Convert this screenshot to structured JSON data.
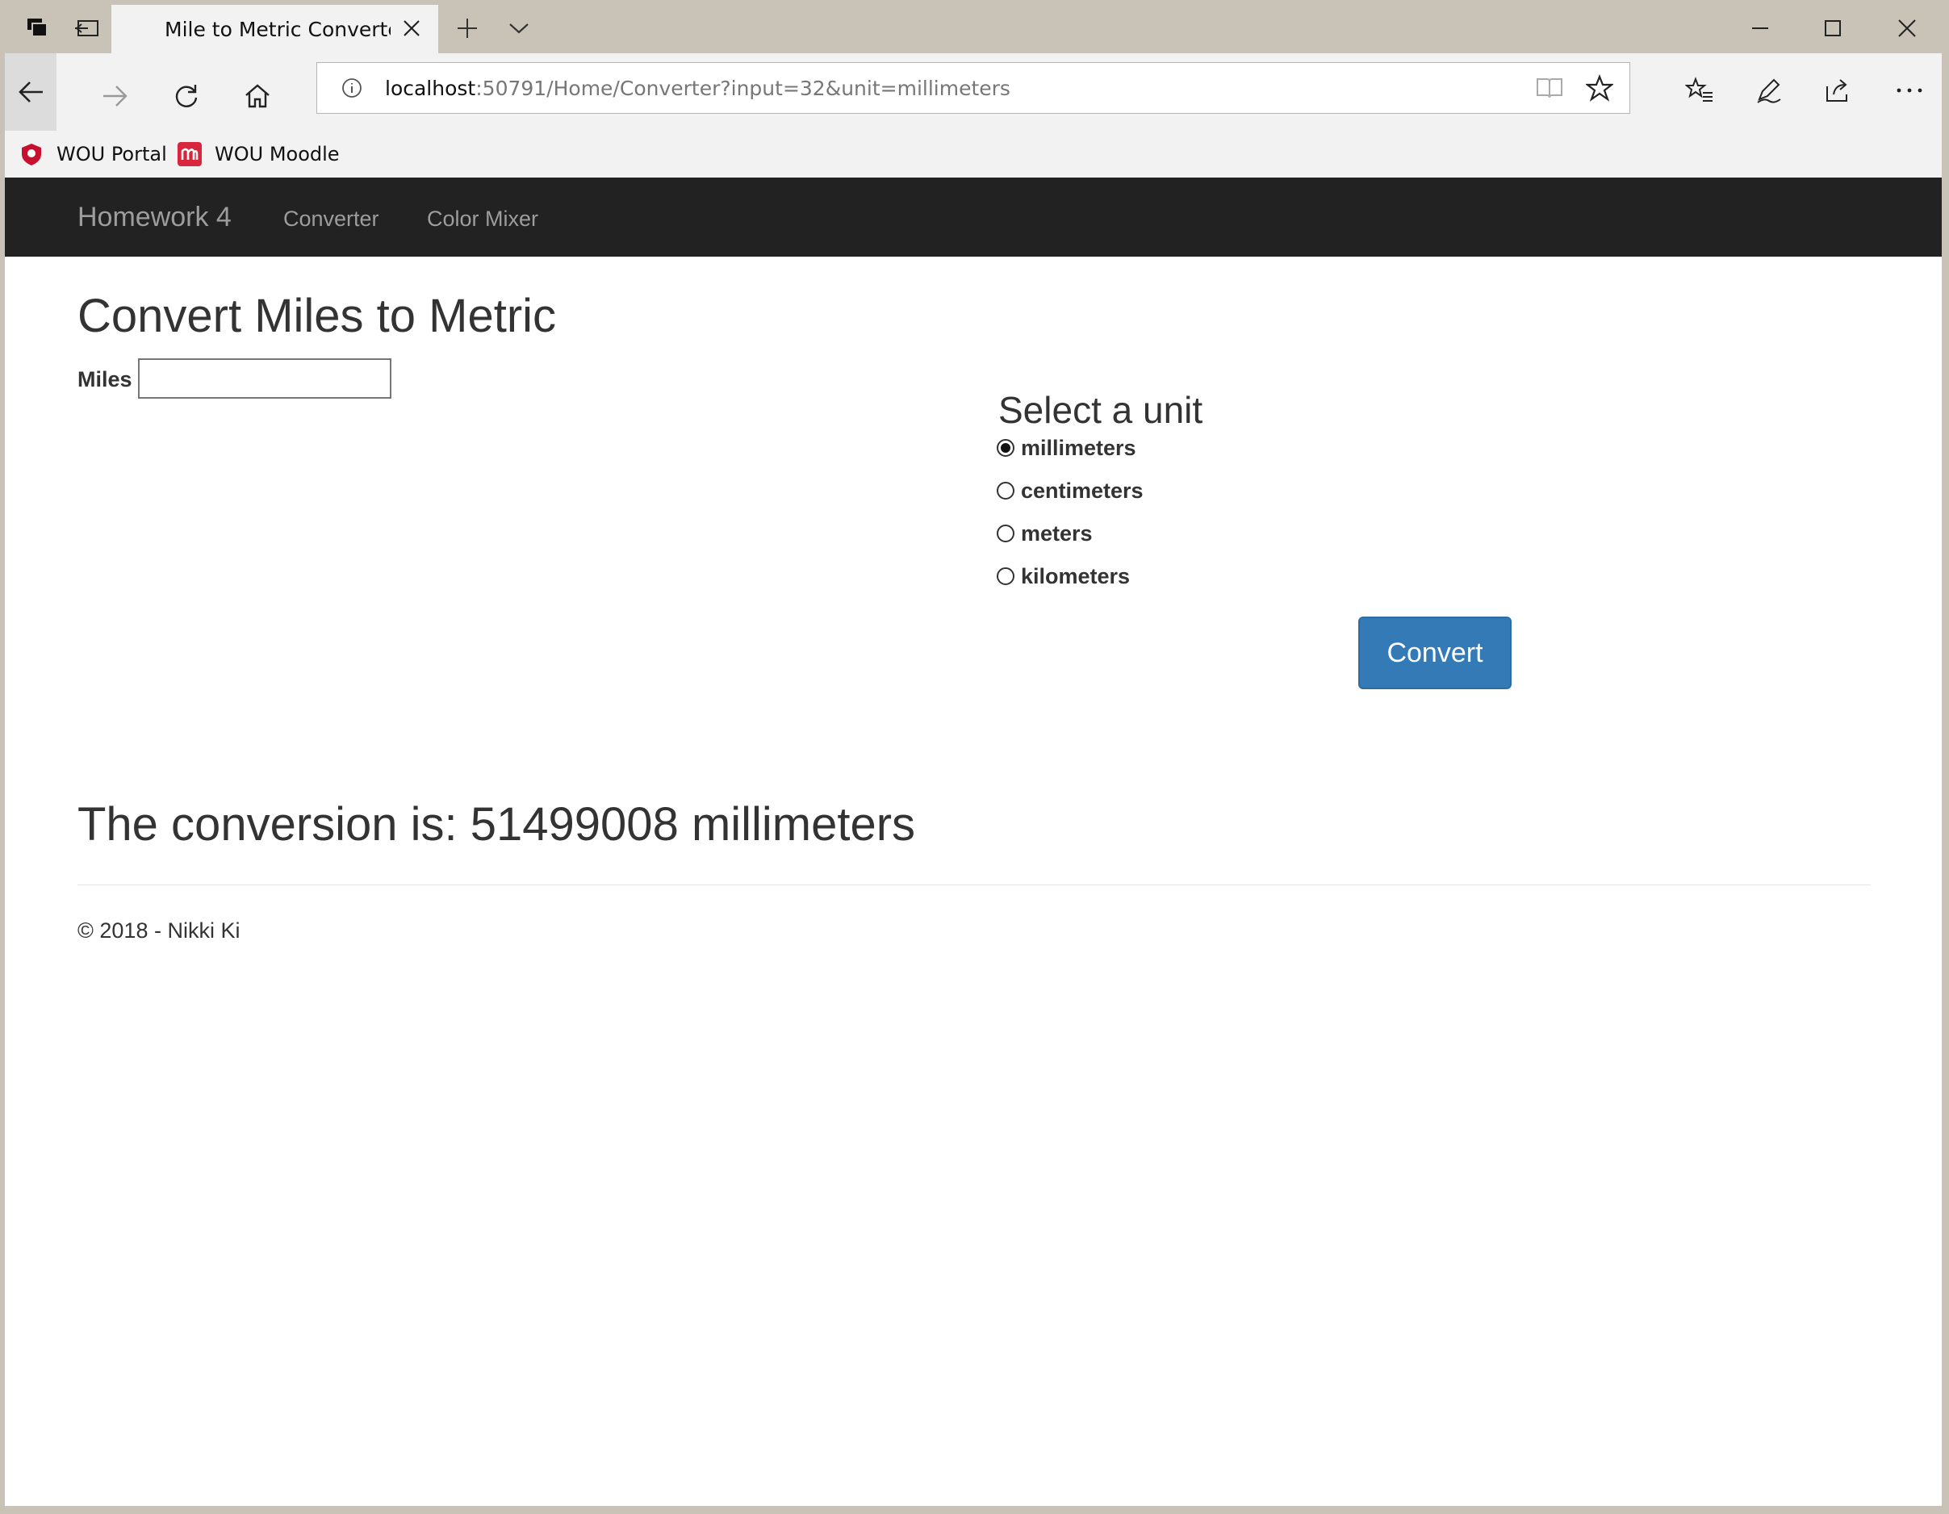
{
  "browser": {
    "tab_title": "Mile to Metric Converte",
    "url_host": "localhost",
    "url_path": ":50791/Home/Converter?input=32&unit=millimeters",
    "favorites": [
      {
        "label": "WOU Portal",
        "icon": "wou-portal-shield-icon",
        "color": "#c8102e"
      },
      {
        "label": "WOU Moodle",
        "icon": "moodle-m-icon",
        "color": "#d7263d"
      }
    ]
  },
  "site": {
    "brand": "Homework 4",
    "nav": [
      "Converter",
      "Color Mixer"
    ],
    "navbar_color": "#222222"
  },
  "page": {
    "heading": "Convert Miles to Metric",
    "miles_label": "Miles",
    "miles_value": "",
    "unit_heading": "Select a unit",
    "units": [
      {
        "label": "millimeters",
        "checked": true
      },
      {
        "label": "centimeters",
        "checked": false
      },
      {
        "label": "meters",
        "checked": false
      },
      {
        "label": "kilometers",
        "checked": false
      }
    ],
    "convert_label": "Convert",
    "button_color": "#337ab7",
    "result": "The conversion is: 51499008 millimeters",
    "footer": "© 2018 - Nikki Ki"
  }
}
